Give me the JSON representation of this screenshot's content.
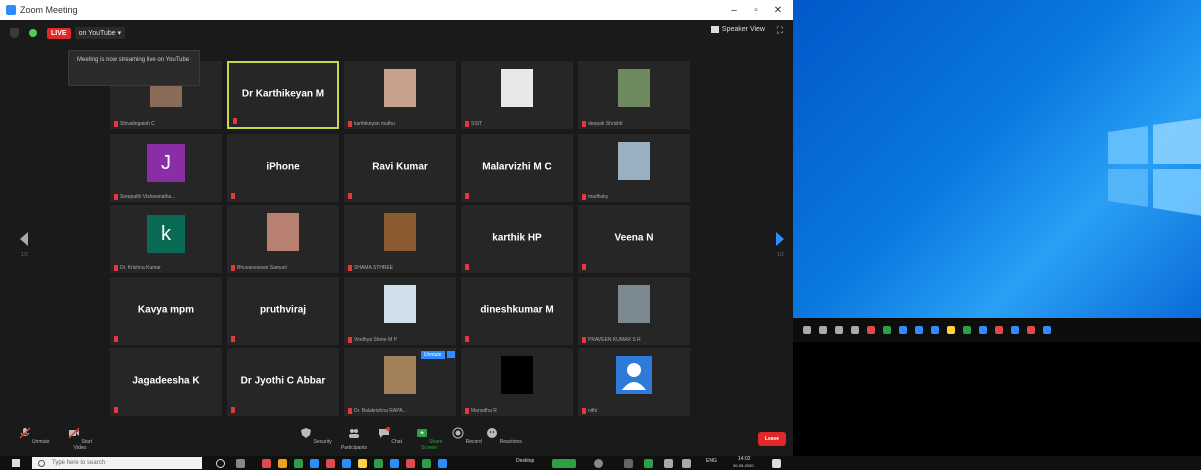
{
  "window": {
    "title": "Zoom Meeting"
  },
  "topbar": {
    "live_badge": "LIVE",
    "stream_target": "on YouTube ▾",
    "view_mode": "Speaker View"
  },
  "tooltip": {
    "text": "Meeting is now streaming live on YouTube"
  },
  "participants": [
    {
      "name": "",
      "label": "Shivalingaiah C",
      "type": "photo",
      "photo_bg": "#8b6b5a"
    },
    {
      "name": "Dr Karthikeyan M",
      "label": "",
      "type": "name",
      "active": true
    },
    {
      "name": "",
      "label": "karthikeyan muthu",
      "type": "photo",
      "photo_bg": "#c7a08c"
    },
    {
      "name": "",
      "label": "SSIT",
      "type": "photo",
      "photo_bg": "#e8e8e8"
    },
    {
      "name": "",
      "label": "deepak Shrishti",
      "type": "photo",
      "photo_bg": "#6f8a5f"
    },
    {
      "name": "",
      "label": "Sreepathi Vishwanatha...",
      "type": "letter",
      "letter": "J",
      "letter_bg": "#8a2ea8"
    },
    {
      "name": "iPhone",
      "label": "",
      "type": "name"
    },
    {
      "name": "Ravi Kumar",
      "label": "",
      "type": "name"
    },
    {
      "name": "Malarvizhi M C",
      "label": "",
      "type": "name"
    },
    {
      "name": "",
      "label": "madhuky",
      "type": "photo",
      "photo_bg": "#9ab0c0"
    },
    {
      "name": "",
      "label": "Dr. Krishna Kumar",
      "type": "letter",
      "letter": "k",
      "letter_bg": "#0a6a55"
    },
    {
      "name": "",
      "label": "Bhuvaneswari Samuel",
      "type": "photo",
      "photo_bg": "#b88070"
    },
    {
      "name": "",
      "label": "SHAMA STHREE",
      "type": "photo",
      "photo_bg": "#8a5a30"
    },
    {
      "name": "karthik HP",
      "label": "",
      "type": "name"
    },
    {
      "name": "Veena N",
      "label": "",
      "type": "name"
    },
    {
      "name": "Kavya mpm",
      "label": "",
      "type": "name"
    },
    {
      "name": "pruthviraj",
      "label": "",
      "type": "name"
    },
    {
      "name": "",
      "label": "Vindhya Shree M P",
      "type": "photo",
      "photo_bg": "#cfe0ea"
    },
    {
      "name": "dineshkumar M",
      "label": "",
      "type": "name"
    },
    {
      "name": "",
      "label": "PRAVEEN KUMAR S R",
      "type": "photo",
      "photo_bg": "#7a8a90"
    },
    {
      "name": "Jagadeesha K",
      "label": "",
      "type": "name"
    },
    {
      "name": "Dr Jyothi C Abbar",
      "label": "",
      "type": "name"
    },
    {
      "name": "",
      "label": "Dr. Balakrishna RAPA...",
      "type": "photo",
      "photo_bg": "#a08058"
    },
    {
      "name": "",
      "label": "Manodha R",
      "type": "photo",
      "photo_bg": "#000000"
    },
    {
      "name": "",
      "label": "nithi",
      "type": "avatar",
      "photo_bg": "#2d7ad8"
    }
  ],
  "floating": {
    "unmute": "Unmute"
  },
  "toolbar": {
    "unmute": "Unmute",
    "start_video": "Start Video",
    "security": "Security",
    "participants": "Participants",
    "chat": "Chat",
    "share_screen": "Share Screen",
    "record": "Record",
    "reactions": "Reactions",
    "leave": "Leave"
  },
  "taskbar": {
    "search_placeholder": "Type here to search",
    "desktop_label": "Desktop",
    "language": "ENG",
    "time": "14:02",
    "date": "30-09-2020"
  },
  "colors": {
    "zoom_blue": "#2d8cff",
    "live_red": "#e02828",
    "active_border": "#c7d64a",
    "muted_mic": "#e53935"
  }
}
